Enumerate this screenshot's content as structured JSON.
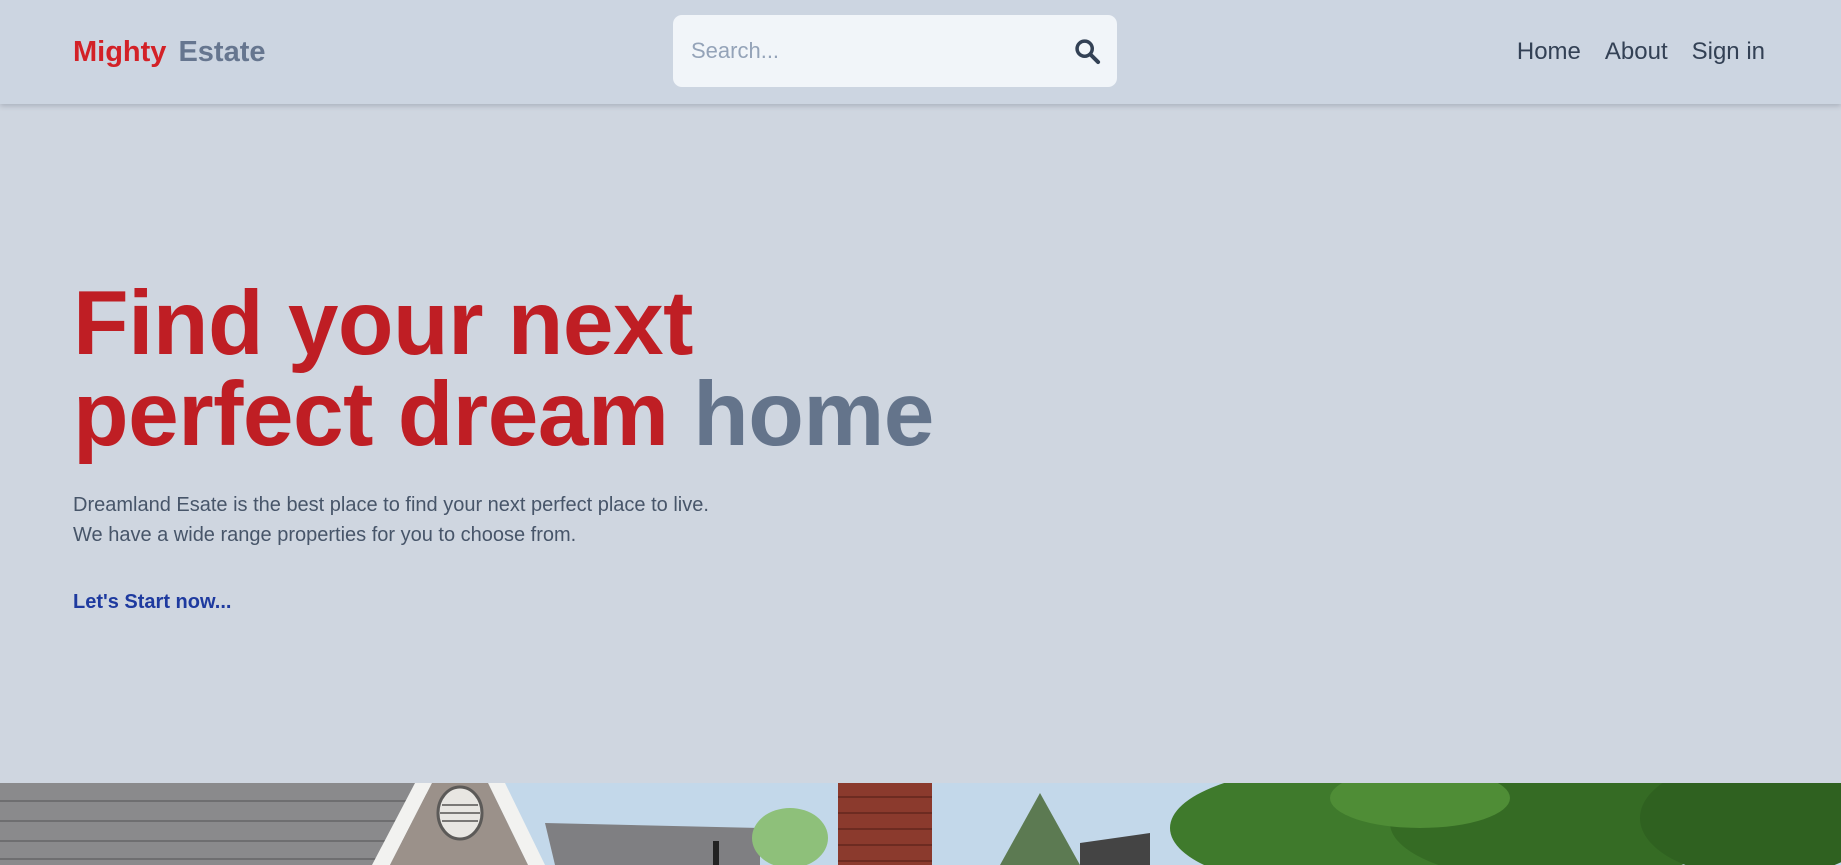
{
  "header": {
    "logo_first": "Mighty",
    "logo_second": "Estate",
    "search_placeholder": "Search...",
    "nav": [
      {
        "label": "Home"
      },
      {
        "label": "About"
      },
      {
        "label": "Sign in"
      }
    ]
  },
  "hero": {
    "title_line1": "Find your next",
    "title_line2_highlight": "perfect dream",
    "title_line2_muted": "home",
    "description_line1": "Dreamland Esate is the best place to find your next perfect place to live.",
    "description_line2": "We have a wide range properties for you to choose from.",
    "cta": "Let's Start now..."
  },
  "colors": {
    "brand_red": "#d32127",
    "title_red": "#bf1e24",
    "muted_slate": "#64748b",
    "link_blue": "#1e3a9f",
    "background": "#cfd6e0"
  },
  "icons": {
    "search": "search-icon"
  }
}
